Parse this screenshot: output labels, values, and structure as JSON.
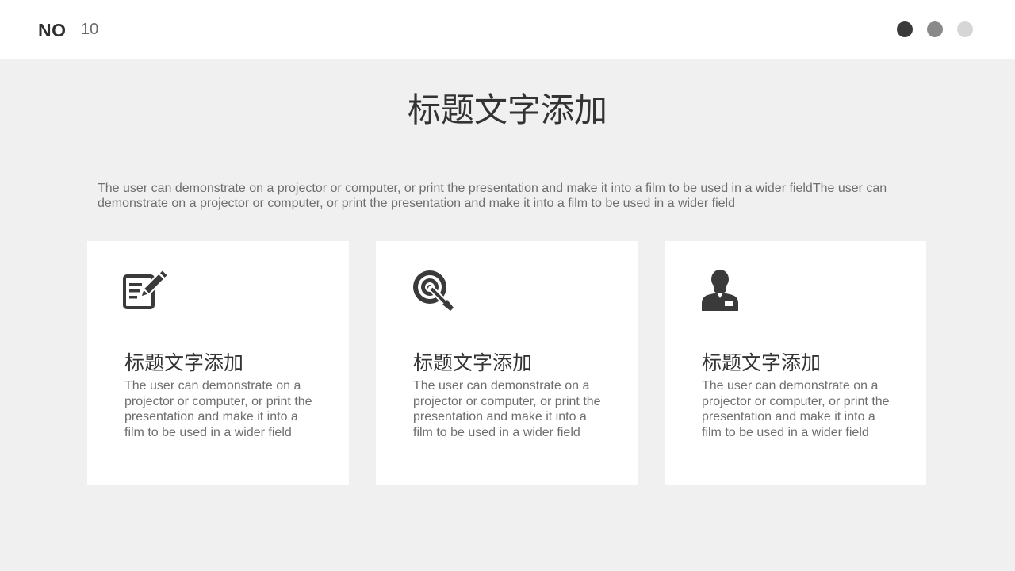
{
  "header": {
    "no_label": "NO",
    "page_number": "10",
    "dots": [
      {
        "color": "#3a3a3a"
      },
      {
        "color": "#8a8a8a"
      },
      {
        "color": "#d6d6d6"
      }
    ]
  },
  "main": {
    "title": "标题文字添加",
    "intro": "The user can demonstrate on a projector or computer, or print the presentation and make it into a film to be used in a wider fieldThe user can demonstrate on a projector or computer, or print the presentation and make it into a film to be used in a wider field"
  },
  "cards": [
    {
      "icon": "edit-document-icon",
      "title": "标题文字添加",
      "text": "The user can demonstrate on a projector or computer, or print the presentation and make it into a film to be used in a wider field"
    },
    {
      "icon": "target-icon",
      "title": "标题文字添加",
      "text": "The user can demonstrate on a projector or computer, or print the presentation and make it into a film to be used in a wider field"
    },
    {
      "icon": "person-badge-icon",
      "title": "标题文字添加",
      "text": "The user can demonstrate on a projector or computer, or print the presentation and make it into a film to be used in a wider field"
    }
  ],
  "colors": {
    "background": "#f0f0f0",
    "card": "#ffffff",
    "icon": "#3a3a3a",
    "title_text": "#333333",
    "body_text": "#6e6e6e"
  }
}
